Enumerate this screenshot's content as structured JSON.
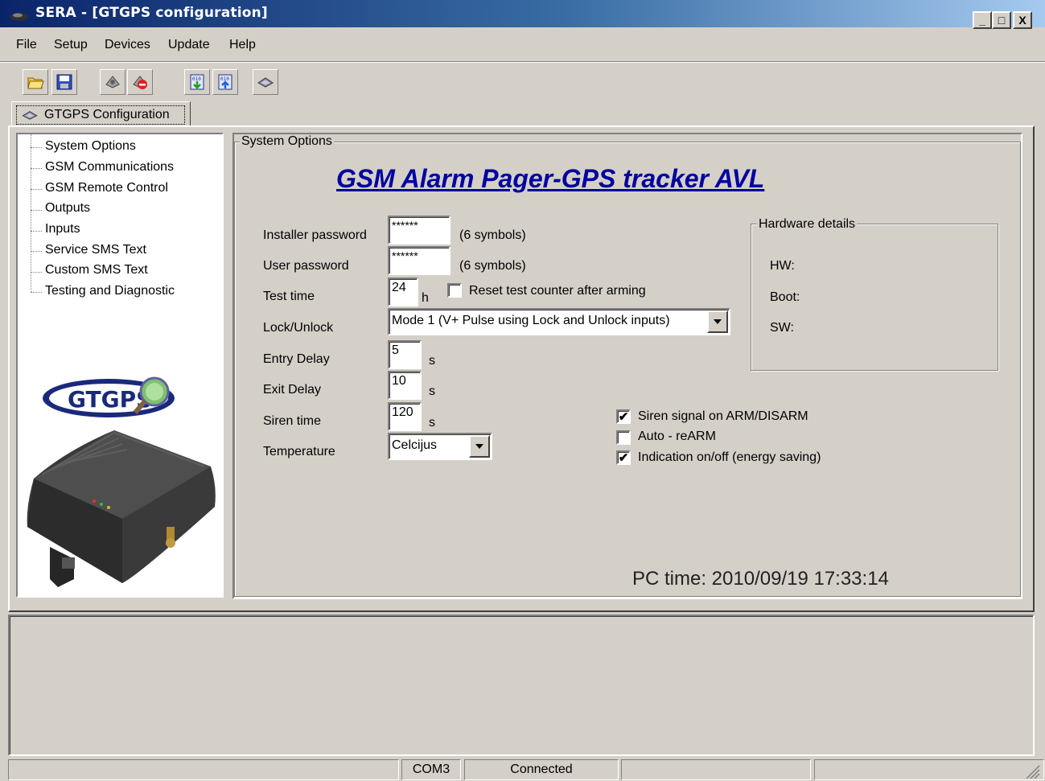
{
  "window": {
    "title": "SERA - [GTGPS configuration]",
    "minimize_glyph": "_",
    "maximize_glyph": "□",
    "close_glyph": "X"
  },
  "menu": [
    {
      "label": "File"
    },
    {
      "label": "Setup"
    },
    {
      "label": "Devices"
    },
    {
      "label": "Update"
    },
    {
      "label": "Help"
    }
  ],
  "toolbar": {
    "icons": [
      "open-folder-icon",
      "save-disk-icon",
      "connect-icon",
      "disconnect-icon",
      "download-firmware-icon",
      "upload-firmware-icon",
      "device-icon"
    ]
  },
  "tab": {
    "label": "GTGPS Configuration"
  },
  "tree": {
    "items": [
      "System Options",
      "GSM Communications",
      "GSM Remote Control",
      "Outputs",
      "Inputs",
      "Service SMS Text",
      "Custom SMS Text",
      "Testing and Diagnostic"
    ]
  },
  "logo": {
    "text": "GTGPS"
  },
  "system_options": {
    "group_label": "System Options",
    "heading": "GSM Alarm Pager-GPS tracker AVL",
    "installer_password": {
      "label": "Installer password",
      "value": "******",
      "hint": "(6 symbols)"
    },
    "user_password": {
      "label": "User password",
      "value": "******",
      "hint": "(6 symbols)"
    },
    "test_time": {
      "label": "Test time",
      "value": "24",
      "unit": "h",
      "reset_label": "Reset test counter after arming",
      "reset_checked": false
    },
    "lock_unlock": {
      "label": "Lock/Unlock",
      "value": "Mode 1 (V+ Pulse using Lock and Unlock inputs)"
    },
    "entry_delay": {
      "label": "Entry Delay",
      "value": "5",
      "unit": "s"
    },
    "exit_delay": {
      "label": "Exit Delay",
      "value": "10",
      "unit": "s"
    },
    "siren_time": {
      "label": "Siren time",
      "value": "120",
      "unit": "s"
    },
    "temperature": {
      "label": "Temperature",
      "value": "Celcijus"
    },
    "checkboxes": [
      {
        "label": "Siren signal on ARM/DISARM",
        "checked": true
      },
      {
        "label": "Auto - reARM",
        "checked": false
      },
      {
        "label": "Indication on/off (energy saving)",
        "checked": true
      }
    ],
    "pc_time": "PC time: 2010/09/19 17:33:14"
  },
  "hardware": {
    "group_label": "Hardware details",
    "hw_label": "HW:",
    "boot_label": "Boot:",
    "sw_label": "SW:"
  },
  "statusbar": {
    "port": "COM3",
    "state": "Connected"
  }
}
